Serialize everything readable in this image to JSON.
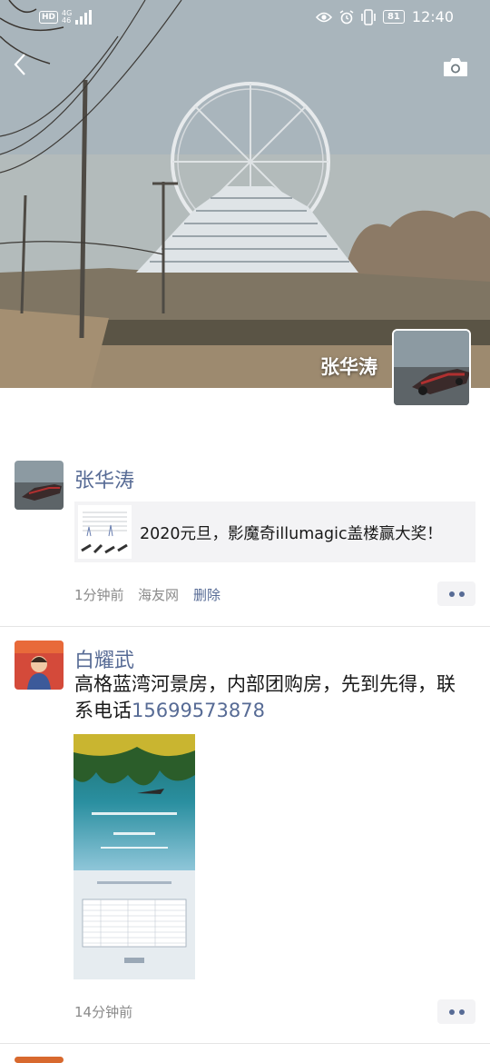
{
  "status_bar": {
    "hd": "HD",
    "network_top": "4G",
    "network_bottom": "46",
    "battery": "81",
    "time": "12:40"
  },
  "header": {
    "back_icon": "chevron-left-icon",
    "camera_icon": "camera-icon"
  },
  "cover": {
    "user_name": "张华涛"
  },
  "feed": {
    "posts": [
      {
        "name": "张华涛",
        "link_title": "2020元旦，影魔奇illumagic盖楼赢大奖！",
        "time": "1分钟前",
        "source": "海友网",
        "delete": "删除"
      },
      {
        "name": "白耀武",
        "text": "高格蓝湾河景房，内部团购房，先到先得，联系电话",
        "phone": "15699573878",
        "time": "14分钟前"
      }
    ]
  },
  "colors": {
    "link_blue": "#576b95",
    "meta_gray": "#8a8a8a",
    "card_bg": "#f3f3f5"
  }
}
